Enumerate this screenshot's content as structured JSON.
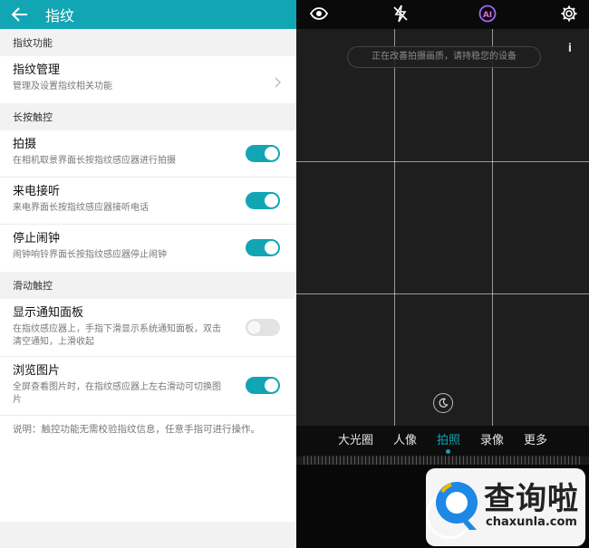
{
  "settings": {
    "title": "指纹",
    "sections": [
      {
        "header": "指纹功能"
      },
      {
        "header": "长按触控"
      },
      {
        "header": "滑动触控"
      }
    ],
    "items": {
      "manage": {
        "title": "指纹管理",
        "sub": "管理及设置指纹相关功能"
      },
      "shoot": {
        "title": "拍摄",
        "sub": "在相机取景界面长按指纹感应器进行拍摄",
        "on": true
      },
      "answer": {
        "title": "来电接听",
        "sub": "来电界面长按指纹感应器接听电话",
        "on": true
      },
      "alarm": {
        "title": "停止闹钟",
        "sub": "闹钟响铃界面长按指纹感应器停止闹钟",
        "on": true
      },
      "notify": {
        "title": "显示通知面板",
        "sub": "在指纹感应器上，手指下滑显示系统通知面板，双击清空通知，上滑收起",
        "on": false
      },
      "photos": {
        "title": "浏览图片",
        "sub": "全屏查看图片时，在指纹感应器上左右滑动可切换图片",
        "on": true
      }
    },
    "note": "说明：触控功能无需校验指纹信息，任意手指可进行操作。"
  },
  "camera": {
    "toast": "正在改善拍摄画质，请持稳您的设备",
    "info": "i",
    "ai_label": "AI",
    "modes": [
      "大光圈",
      "人像",
      "拍照",
      "录像",
      "更多"
    ],
    "active_mode": "拍照"
  },
  "watermark": {
    "text": "查询啦",
    "url": "chaxunla.com"
  },
  "colors": {
    "accent": "#12a5b3"
  }
}
